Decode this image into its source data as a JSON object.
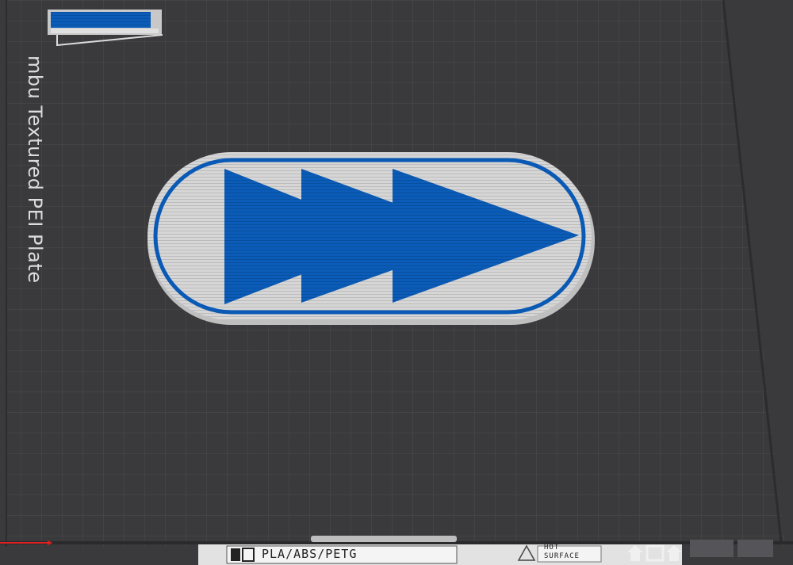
{
  "plate": {
    "name": "mbu Textured PEI Plate",
    "filament_types": "PLA/ABS/PETG",
    "warning_line1": "HOT",
    "warning_line2": "SURFACE"
  },
  "colors": {
    "bed": "#3a3a3d",
    "grid": "#4b4b4f",
    "model_blue": "#0a5ab5",
    "model_white": "#d8d8d8"
  }
}
